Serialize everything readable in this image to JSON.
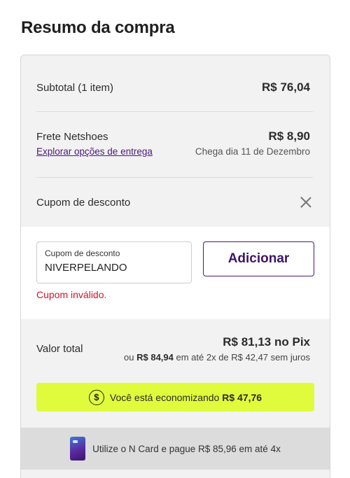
{
  "title": "Resumo da compra",
  "subtotal": {
    "label": "Subtotal (1 item)",
    "value": "R$ 76,04"
  },
  "shipping": {
    "label": "Frete Netshoes",
    "value": "R$ 8,90",
    "link": "Explorar opções de entrega",
    "delivery": "Chega dia 11 de Dezembro"
  },
  "coupon": {
    "heading": "Cupom de desconto",
    "close_icon": "close-icon",
    "field_label": "Cupom de desconto",
    "field_value": "NIVERPELANDO",
    "button": "Adicionar",
    "error": "Cupom inválido."
  },
  "total": {
    "label": "Valor total",
    "pix": "R$ 81,13 no Pix",
    "install_prefix": "ou",
    "install_price": "R$ 84,94",
    "install_suffix": "em até 2x de R$ 42,47 sem juros"
  },
  "savings": {
    "icon": "dollar-coin-icon",
    "text": "Você está economizando",
    "amount": "R$ 47,76",
    "color": "#e0fb3b"
  },
  "ncard": {
    "icon": "credit-card-icon",
    "text": "Utilize o N Card e pague R$ 85,96 em até 4x"
  },
  "colors": {
    "brand_purple": "#4a1a7a",
    "error_red": "#d4132b",
    "card_bg": "#f2f2f2"
  }
}
